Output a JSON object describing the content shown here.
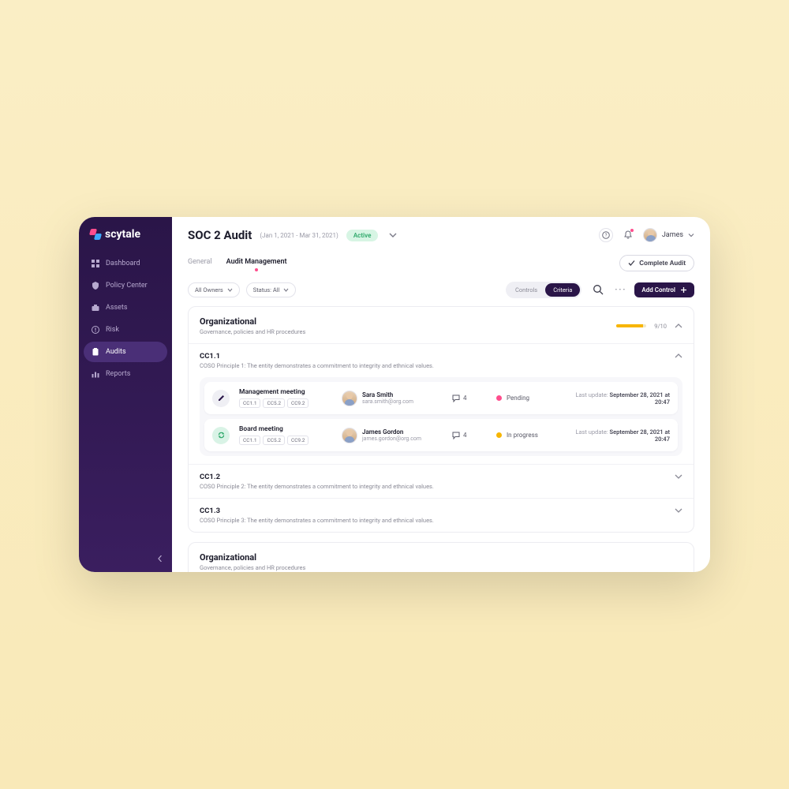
{
  "brand": "scytale",
  "sidebar": {
    "items": [
      {
        "label": "Dashboard",
        "icon": "dashboard"
      },
      {
        "label": "Policy Center",
        "icon": "shield"
      },
      {
        "label": "Assets",
        "icon": "briefcase"
      },
      {
        "label": "Risk",
        "icon": "alert"
      },
      {
        "label": "Audits",
        "icon": "clipboard"
      },
      {
        "label": "Reports",
        "icon": "bars"
      }
    ],
    "active_index": 4
  },
  "header": {
    "title": "SOC 2 Audit",
    "date_range": "(Jan 1, 2021 - Mar 31, 2021)",
    "status_badge": "Active",
    "user": {
      "name": "James"
    }
  },
  "tabs": {
    "items": [
      "General",
      "Audit Management"
    ],
    "active_index": 1,
    "complete_label": "Complete Audit"
  },
  "toolbar": {
    "filters": [
      {
        "label": "All Owners"
      },
      {
        "label": "Status: All"
      }
    ],
    "segmented": {
      "options": [
        "Controls",
        "Criteria"
      ],
      "active_index": 1
    },
    "add_label": "Add Control"
  },
  "sections": [
    {
      "title": "Organizational",
      "subtitle": "Governance, policies and HR procedures",
      "progress": {
        "value": 9,
        "max": 10,
        "label": "9/10"
      },
      "expanded": true,
      "subsections": [
        {
          "code": "CC1.1",
          "desc": "COSO Principle 1: The entity demonstrates a commitment to integrity and ethnical values.",
          "expanded": true,
          "items": [
            {
              "icon": "pen",
              "title": "Management meeting",
              "tags": [
                "CC1.1",
                "CC5.2",
                "CC9.2"
              ],
              "owner": {
                "name": "Sara Smith",
                "email": "sara.smith@org.com"
              },
              "comments": 4,
              "status": {
                "kind": "pending",
                "label": "Pending"
              },
              "last_update_prefix": "Last update:",
              "last_update": "September 28, 2021 at 20:47"
            },
            {
              "icon": "sync",
              "title": "Board meeting",
              "tags": [
                "CC1.1",
                "CC5.2",
                "CC9.2"
              ],
              "owner": {
                "name": "James Gordon",
                "email": "james.gordon@org.com"
              },
              "comments": 4,
              "status": {
                "kind": "progress",
                "label": "In progress"
              },
              "last_update_prefix": "Last update:",
              "last_update": "September 28, 2021 at 20:47"
            }
          ]
        },
        {
          "code": "CC1.2",
          "desc": "COSO Principle 2: The entity demonstrates a commitment to integrity and ethnical values.",
          "expanded": false
        },
        {
          "code": "CC1.3",
          "desc": "COSO Principle 3: The entity demonstrates a commitment to integrity and ethnical values.",
          "expanded": false
        }
      ]
    },
    {
      "title": "Organizational",
      "subtitle": "Governance, policies and HR procedures",
      "expanded": false
    }
  ]
}
